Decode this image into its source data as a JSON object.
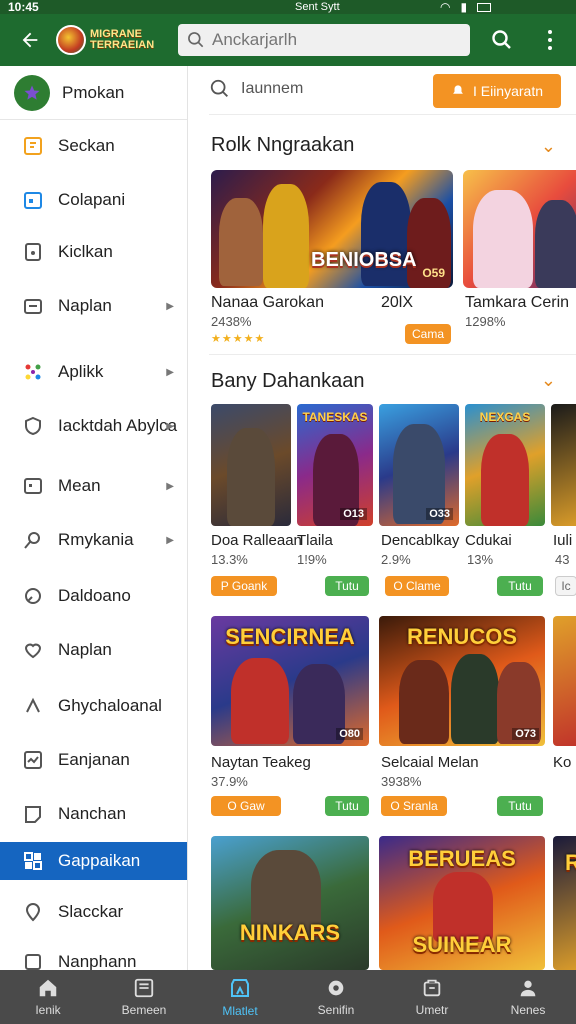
{
  "status_bar": {
    "time": "10:45",
    "carrier": "Sent Sytt"
  },
  "app_bar": {
    "logo_line1": "MIGRANE",
    "logo_line2": "TERRAEIAN",
    "search_placeholder": "Anckarjarlh"
  },
  "sidebar": {
    "header_label": "Pmokan",
    "items": [
      {
        "label": "Seckan",
        "icon": "note-icon",
        "has_arrow": false
      },
      {
        "label": "Colapani",
        "icon": "calendar-icon",
        "has_arrow": false
      },
      {
        "label": "Kiclkan",
        "icon": "document-icon",
        "has_arrow": false
      },
      {
        "label": "Naplan",
        "icon": "folder-icon",
        "has_arrow": true
      },
      {
        "label": "Aplikk",
        "icon": "apps-icon",
        "has_arrow": true
      },
      {
        "label": "Iacktdah Abylca",
        "icon": "shield-icon",
        "has_arrow": true
      },
      {
        "label": "Mean",
        "icon": "card-icon",
        "has_arrow": true
      },
      {
        "label": "Rmykania",
        "icon": "pin-icon",
        "has_arrow": true
      },
      {
        "label": "Daldoano",
        "icon": "target-icon",
        "has_arrow": false
      },
      {
        "label": "Naplan",
        "icon": "heart-icon",
        "has_arrow": false
      },
      {
        "label": "Ghychaloanal",
        "icon": "link-icon",
        "has_arrow": false
      },
      {
        "label": "Eanjanan",
        "icon": "chart-icon",
        "has_arrow": false
      },
      {
        "label": "Nanchan",
        "icon": "tag-icon",
        "has_arrow": false
      },
      {
        "label": "Gappaikan",
        "icon": "grid-icon",
        "has_arrow": false,
        "active": true
      },
      {
        "label": "Slacckar",
        "icon": "location-icon",
        "has_arrow": false
      },
      {
        "label": "Nanphann",
        "icon": "box-icon",
        "has_arrow": false
      }
    ]
  },
  "content": {
    "search_text": "Iaunnem",
    "cta_label": "I Eiinyaratn",
    "section1_title": "Rolk Nngraakan",
    "featured": [
      {
        "name": "Nanaa Garokan",
        "size": "20lX",
        "sub": "2438%",
        "stars": "★★★★★",
        "banner_text": "BENIOBSA",
        "corner": "O59",
        "button": "Cama"
      },
      {
        "name": "Tamkara Cerin",
        "sub": "1298%",
        "corner": ""
      }
    ],
    "section2_title": "Bany Dahankaan",
    "row1": [
      {
        "name": "Doa Ralleaan",
        "sub": "13.3%",
        "btn": "P Goank",
        "btn_color": "orange",
        "title": "",
        "corner": ""
      },
      {
        "name": "Tlaila",
        "sub": "1!9%",
        "btn": "Tutu",
        "btn_color": "green",
        "title": "TANESKAS",
        "corner": "O13"
      },
      {
        "name": "Dencablkay",
        "sub": "2.9%",
        "btn": "O Clame",
        "btn_color": "orange",
        "title": "",
        "corner": "O33"
      },
      {
        "name": "Cdukai",
        "sub": "13%",
        "btn": "Tutu",
        "btn_color": "green",
        "title": "NEXGAS",
        "corner": ""
      },
      {
        "name": "Iuli",
        "sub": "43",
        "btn": "Ic",
        "btn_color": "grey",
        "title": "",
        "corner": ""
      }
    ],
    "row2": [
      {
        "name": "Naytan Teakeg",
        "sub": "37.9%",
        "btn": "O Gaw",
        "btn2": "Tutu",
        "title": "SENCIRNEA",
        "corner": "O80"
      },
      {
        "name": "Selcaial Melan",
        "sub": "3938%",
        "btn": "O Sranla",
        "btn2": "Tutu",
        "title": "RENUCOS",
        "corner": "O73"
      },
      {
        "name": "Ko",
        "sub": ""
      }
    ],
    "row3": [
      {
        "title": "NINKARS"
      },
      {
        "title": "SUINEAR",
        "top": "BERUEAS"
      },
      {
        "title": "R"
      }
    ]
  },
  "bottom_nav": [
    {
      "label": "Ienik",
      "icon": "home-icon"
    },
    {
      "label": "Bemeen",
      "icon": "book-icon"
    },
    {
      "label": "Mlatlet",
      "icon": "market-icon",
      "active": true
    },
    {
      "label": "Senifin",
      "icon": "gear-icon"
    },
    {
      "label": "Umetr",
      "icon": "store-icon"
    },
    {
      "label": "Nenes",
      "icon": "person-icon"
    }
  ],
  "colors": {
    "appbar": "#1e6b2f",
    "accent": "#f39323",
    "active": "#1565c0",
    "green": "#4caf50"
  }
}
